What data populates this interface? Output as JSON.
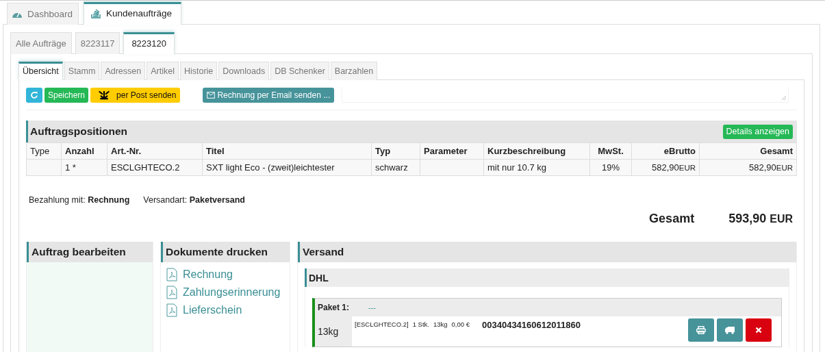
{
  "main_tabs": [
    {
      "label": "Dashboard",
      "selected": false
    },
    {
      "label": "Kundenaufträge",
      "selected": true
    }
  ],
  "order_tabs": [
    {
      "label": "Alle Aufträge",
      "selected": false
    },
    {
      "label": "8223117",
      "selected": false
    },
    {
      "label": "8223120",
      "selected": true
    }
  ],
  "section_tabs": [
    {
      "label": "Übersicht",
      "selected": true
    },
    {
      "label": "Stamm",
      "selected": false
    },
    {
      "label": "Adressen",
      "selected": false
    },
    {
      "label": "Artikel",
      "selected": false
    },
    {
      "label": "Historie",
      "selected": false
    },
    {
      "label": "Downloads",
      "selected": false
    },
    {
      "label": "DB Schenker",
      "selected": false
    },
    {
      "label": "Barzahlen",
      "selected": false
    }
  ],
  "toolbar": [
    {
      "kind": "refresh"
    },
    {
      "kind": "success",
      "label": "Speichern"
    },
    {
      "kind": "post",
      "label": "per Post senden"
    },
    {
      "kind": "email",
      "label": "Rechnung per Email senden ..."
    }
  ],
  "positions": {
    "title": "Auftragspositionen",
    "details_button": "Details anzeigen",
    "columns": [
      {
        "label": "Type",
        "bold": false
      },
      {
        "label": "Anzahl",
        "bold": true
      },
      {
        "label": "Art.-Nr.",
        "bold": true
      },
      {
        "label": "Titel",
        "bold": true
      },
      {
        "label": "Typ",
        "bold": true
      },
      {
        "label": "Parameter",
        "bold": true
      },
      {
        "label": "Kurzbeschreibung",
        "bold": true
      },
      {
        "label": "MwSt.",
        "bold": true
      },
      {
        "label": "eBrutto",
        "bold": true
      },
      {
        "label": "Gesamt",
        "bold": true
      }
    ],
    "rows": [
      {
        "cells": [
          {},
          {
            "value": "1 *"
          },
          {
            "value": "ESCLGHTECO.2"
          },
          {
            "value": "SXT light Eco - (zweit)leichtester"
          },
          {
            "value": "schwarz"
          },
          {},
          {
            "value": "mit nur 10.7 kg"
          },
          {
            "value": "19%"
          },
          {
            "value": "582,90",
            "unit": "EUR"
          },
          {
            "value": "582,90",
            "unit": "EUR"
          }
        ]
      }
    ]
  },
  "payment": {
    "label": "Bezahlung mit:",
    "value": "Rechnung"
  },
  "shipping_method": {
    "label": "Versandart:",
    "value": "Paketversand"
  },
  "total": {
    "label": "Gesamt",
    "value": "593,90",
    "unit": "EUR"
  },
  "edit_panel": {
    "title": "Auftrag bearbeiten"
  },
  "print_panel": {
    "title": "Dokumente drucken",
    "documents": [
      "Rechnung",
      "Zahlungserinnerung",
      "Lieferschein"
    ]
  },
  "shipping_panel": {
    "title": "Versand",
    "carrier": "DHL",
    "packages": [
      {
        "label": "Paket 1:",
        "link": "---",
        "weight": "13kg",
        "contents": [
          "[ESCLGHTECO.2]",
          "1 Stk.",
          "13kg",
          "0,00 €"
        ],
        "tracking": "00340434160612011860"
      }
    ]
  }
}
